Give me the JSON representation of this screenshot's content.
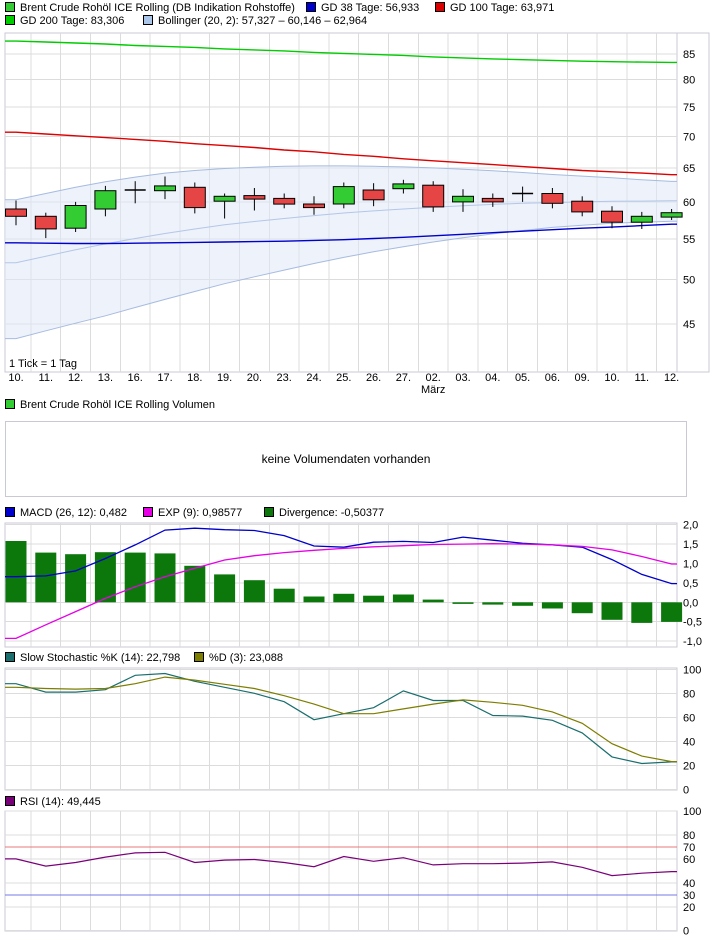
{
  "title": "Brent Crude Rohöl ICE Rolling Chart",
  "colors": {
    "grid": "#dcdcdc",
    "frame": "#c9c9d4",
    "text": "#000000",
    "muted_text": "#a8a8a8",
    "candle_up": "#33cc33",
    "candle_down": "#e64545",
    "candle_border": "#000000",
    "doji": "#000000",
    "gd38": "#0000cc",
    "gd100": "#dd0000",
    "gd200": "#00cc00",
    "bollinger_swatch": "#aac6e8",
    "bollinger_band_fill": "#dfe8f8",
    "bollinger_line": "#a6bbe0",
    "bollinger_mid_line": "#b4c6e8",
    "macd_line": "#0000cc",
    "exp_line": "#e600e6",
    "divergence_bar": "#0c780c",
    "stoch_k": "#1a6e6e",
    "stoch_d": "#7d7d00",
    "rsi_line": "#7a007a",
    "rsi_overbought": "#e87878",
    "rsi_oversold": "#7878e8"
  },
  "panels": {
    "main": {
      "legend1": [
        {
          "label": "Brent Crude Rohöl ICE Rolling (DB Indikation Rohstoffe)",
          "color": "#33cc33"
        },
        {
          "label": "GD 38 Tage: 56,933",
          "color": "#0000cc"
        },
        {
          "label": "GD 100 Tage: 63,971",
          "color": "#dd0000"
        }
      ],
      "legend2": [
        {
          "label": "GD 200 Tage: 83,306",
          "color": "#00cc00"
        },
        {
          "label": "Bollinger (20, 2): 57,327 – 60,146 – 62,964",
          "color": "#aac6e8"
        }
      ]
    },
    "volume": {
      "legend": [
        {
          "label": "Brent Crude Rohöl ICE Rolling Volumen",
          "color": "#33cc33"
        }
      ],
      "empty_text": "keine Volumendaten vorhanden"
    },
    "macd": {
      "legend": [
        {
          "label": "MACD (26, 12): 0,482",
          "color": "#0000cc"
        },
        {
          "label": "EXP (9): 0,98577",
          "color": "#e600e6"
        },
        {
          "label": "Divergence: -0,50377",
          "color": "#0c780c"
        }
      ]
    },
    "stochastic": {
      "legend": [
        {
          "label": "Slow Stochastic %K (14): 22,798",
          "color": "#1a6e6e"
        },
        {
          "label": "%D (3): 23,088",
          "color": "#7d7d00"
        }
      ]
    },
    "rsi": {
      "legend": [
        {
          "label": "RSI (14): 49,445",
          "color": "#7a007a"
        }
      ]
    }
  },
  "chart_data": [
    {
      "id": "price",
      "type": "candlestick",
      "title": "Brent Crude Rohöl ICE Rolling (DB Indikation Rohstoffe)",
      "y_scale": "log",
      "y_ticks": [
        85,
        80,
        75,
        70,
        65,
        60,
        55,
        50,
        45
      ],
      "x_categories": [
        "10.",
        "11.",
        "12.",
        "13.",
        "16.",
        "17.",
        "18.",
        "19.",
        "20.",
        "23.",
        "24.",
        "25.",
        "26.",
        "27.",
        "02.",
        "03.",
        "04.",
        "05.",
        "06.",
        "09.",
        "10.",
        "11.",
        "12."
      ],
      "x_month": {
        "label": "März",
        "index": 14
      },
      "tick_note": "1 Tick = 1 Tag",
      "candles": [
        [
          59.0,
          60.2,
          56.8,
          58.0
        ],
        [
          58.0,
          58.5,
          55.1,
          56.3
        ],
        [
          56.4,
          60.0,
          55.9,
          59.5
        ],
        [
          59.0,
          62.3,
          58.0,
          61.6
        ],
        [
          61.7,
          63.0,
          59.8,
          61.7
        ],
        [
          61.6,
          63.7,
          60.4,
          62.3
        ],
        [
          62.1,
          62.8,
          58.4,
          59.2
        ],
        [
          60.1,
          61.2,
          57.7,
          60.8
        ],
        [
          60.9,
          62.0,
          58.8,
          60.4
        ],
        [
          60.5,
          61.2,
          59.1,
          59.7
        ],
        [
          59.7,
          60.8,
          58.2,
          59.2
        ],
        [
          59.7,
          62.8,
          59.1,
          62.2
        ],
        [
          61.7,
          62.7,
          59.4,
          60.3
        ],
        [
          61.9,
          63.2,
          61.2,
          62.6
        ],
        [
          62.4,
          63.0,
          58.6,
          59.3
        ],
        [
          60.0,
          61.8,
          58.6,
          60.8
        ],
        [
          60.5,
          61.2,
          59.3,
          60.0
        ],
        [
          61.2,
          62.2,
          60.0,
          61.2
        ],
        [
          61.2,
          62.0,
          59.1,
          59.8
        ],
        [
          60.1,
          60.8,
          58.0,
          58.6
        ],
        [
          58.7,
          59.4,
          56.4,
          57.2
        ],
        [
          57.2,
          58.6,
          56.3,
          58.0
        ],
        [
          57.9,
          59.0,
          57.5,
          58.5
        ]
      ],
      "series": [
        {
          "name": "GD 38 Tage",
          "current": "56,933",
          "color": "#0000cc",
          "values": [
            54.5,
            54.45,
            54.4,
            54.4,
            54.45,
            54.5,
            54.55,
            54.6,
            54.65,
            54.7,
            54.8,
            54.9,
            55.05,
            55.2,
            55.4,
            55.6,
            55.8,
            56.0,
            56.2,
            56.4,
            56.55,
            56.75,
            56.93
          ]
        },
        {
          "name": "GD 100 Tage",
          "current": "63,971",
          "color": "#dd0000",
          "values": [
            70.7,
            70.4,
            70.1,
            69.8,
            69.5,
            69.2,
            68.8,
            68.5,
            68.2,
            67.8,
            67.5,
            67.1,
            66.8,
            66.4,
            66.1,
            65.8,
            65.5,
            65.2,
            64.9,
            64.6,
            64.4,
            64.2,
            63.97
          ]
        },
        {
          "name": "GD 200 Tage",
          "current": "83,306",
          "color": "#00cc00",
          "values": [
            87.6,
            87.4,
            87.2,
            87.0,
            86.7,
            86.5,
            86.3,
            86.0,
            85.8,
            85.6,
            85.3,
            85.1,
            84.9,
            84.7,
            84.4,
            84.2,
            84.0,
            83.85,
            83.7,
            83.55,
            83.45,
            83.37,
            83.31
          ]
        },
        {
          "name": "Bollinger oben",
          "current": "62,964",
          "color": "#a6bbe0",
          "values": [
            60.3,
            61.2,
            62.1,
            62.9,
            63.6,
            64.2,
            64.6,
            64.9,
            65.1,
            65.25,
            65.3,
            65.3,
            65.25,
            65.15,
            65.0,
            64.8,
            64.55,
            64.3,
            64.0,
            63.75,
            63.5,
            63.2,
            62.96
          ]
        },
        {
          "name": "Bollinger Mitte",
          "current": "60,146",
          "color": "#b4c6e8",
          "values": [
            52.0,
            52.8,
            53.6,
            54.35,
            55.05,
            55.7,
            56.3,
            56.85,
            57.3,
            57.7,
            58.1,
            58.45,
            58.75,
            59.0,
            59.25,
            59.45,
            59.65,
            59.8,
            59.9,
            60.0,
            60.08,
            60.12,
            60.15
          ]
        },
        {
          "name": "Bollinger unten",
          "current": "57,327",
          "color": "#a6bbe0",
          "values": [
            43.5,
            44.3,
            45.1,
            45.9,
            46.8,
            47.7,
            48.6,
            49.5,
            50.3,
            51.1,
            51.9,
            52.65,
            53.35,
            54.0,
            54.6,
            55.15,
            55.65,
            56.1,
            56.5,
            56.8,
            57.05,
            57.2,
            57.33
          ]
        }
      ],
      "band": {
        "fill": "#dfe8f8",
        "opacity": 0.55,
        "upper_index": 3,
        "lower_index": 5
      }
    },
    {
      "id": "volume",
      "type": "none",
      "title": "Brent Crude Rohöl ICE Rolling Volumen",
      "message": "keine Volumendaten vorhanden"
    },
    {
      "id": "macd",
      "type": "macd",
      "y_ticks": [
        {
          "v": 2.0,
          "label": "2,0"
        },
        {
          "v": 1.5,
          "label": "1,5"
        },
        {
          "v": 1.0,
          "label": "1,0"
        },
        {
          "v": 0.5,
          "label": "0,5"
        },
        {
          "v": 0.0,
          "label": "0,0"
        },
        {
          "v": -0.5,
          "label": "-0,5"
        },
        {
          "v": -1.0,
          "label": "-1,0"
        }
      ],
      "bars": {
        "name": "Divergence",
        "current": "-0,50377",
        "color": "#0c780c",
        "values": [
          1.58,
          1.28,
          1.24,
          1.29,
          1.28,
          1.26,
          0.94,
          0.72,
          0.57,
          0.35,
          0.15,
          0.22,
          0.17,
          0.2,
          0.07,
          -0.04,
          -0.06,
          -0.09,
          -0.16,
          -0.28,
          -0.45,
          -0.53,
          -0.504
        ]
      },
      "lines": [
        {
          "name": "MACD (26, 12)",
          "current": "0,482",
          "color": "#0000cc",
          "values": [
            0.66,
            0.68,
            0.81,
            1.13,
            1.48,
            1.86,
            1.91,
            1.87,
            1.85,
            1.72,
            1.45,
            1.42,
            1.55,
            1.57,
            1.54,
            1.68,
            1.6,
            1.52,
            1.48,
            1.42,
            1.1,
            0.72,
            0.482
          ]
        },
        {
          "name": "EXP (9)",
          "current": "0,98577",
          "color": "#e600e6",
          "values": [
            -0.93,
            -0.58,
            -0.24,
            0.1,
            0.4,
            0.66,
            0.88,
            1.09,
            1.2,
            1.28,
            1.34,
            1.39,
            1.43,
            1.46,
            1.49,
            1.5,
            1.51,
            1.5,
            1.48,
            1.44,
            1.35,
            1.18,
            0.986
          ]
        }
      ]
    },
    {
      "id": "stochastic",
      "type": "line",
      "y_ticks": [
        {
          "v": 100,
          "label": "100"
        },
        {
          "v": 80,
          "label": "80"
        },
        {
          "v": 60,
          "label": "60"
        },
        {
          "v": 40,
          "label": "40"
        },
        {
          "v": 20,
          "label": "20"
        },
        {
          "v": 0,
          "label": "0"
        }
      ],
      "lines": [
        {
          "name": "Slow Stochastic %K (14)",
          "current": "22,798",
          "color": "#1a6e6e",
          "values": [
            88,
            81,
            81,
            83,
            95,
            96.5,
            90,
            85,
            80,
            73,
            58,
            63,
            68,
            82,
            74,
            74,
            61.5,
            61,
            57.5,
            47,
            27,
            21.5,
            22.8
          ]
        },
        {
          "name": "%D (3)",
          "current": "23,088",
          "color": "#7d7d00",
          "values": [
            85,
            84,
            83.5,
            84,
            88,
            93.5,
            91,
            87.5,
            84,
            78,
            71,
            63,
            63,
            67,
            71,
            74.5,
            72.5,
            70,
            64.5,
            55,
            38,
            27.7,
            23.1
          ]
        }
      ]
    },
    {
      "id": "rsi",
      "type": "line",
      "y_ticks": [
        {
          "v": 100,
          "label": "100"
        },
        {
          "v": 80,
          "label": "80"
        },
        {
          "v": 60,
          "label": "60"
        },
        {
          "v": 40,
          "label": "40"
        },
        {
          "v": 20,
          "label": "20"
        },
        {
          "v": 0,
          "label": "0"
        }
      ],
      "ref_lines": [
        {
          "v": 70,
          "label": "70",
          "color": "#e87878"
        },
        {
          "v": 30,
          "label": "30",
          "color": "#7878e8"
        }
      ],
      "lines": [
        {
          "name": "RSI (14)",
          "current": "49,445",
          "color": "#7a007a",
          "values": [
            60,
            54,
            57,
            61.5,
            65,
            65.5,
            57,
            59,
            59.5,
            57,
            53.5,
            62,
            58,
            61,
            55,
            56,
            56,
            56.5,
            57.5,
            53,
            46,
            48,
            49.4
          ]
        }
      ]
    }
  ]
}
